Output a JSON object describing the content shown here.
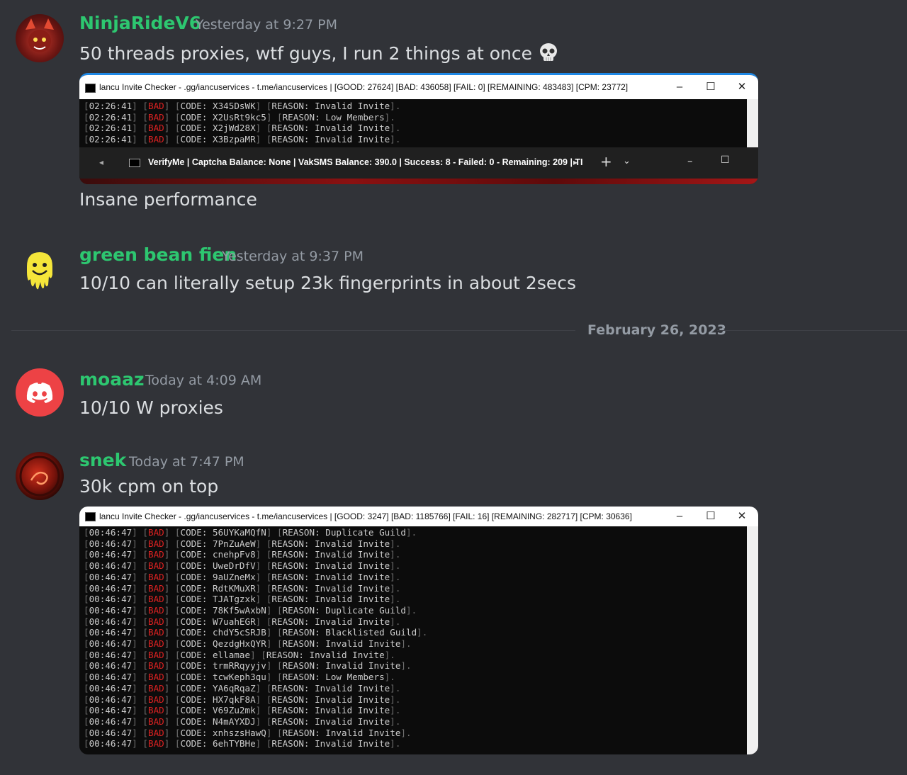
{
  "messages": [
    {
      "author": "NinjaRideV6",
      "timestamp": "Yesterday at 9:27 PM",
      "text": "50 threads proxies, wtf guys, I run 2 things at once",
      "emoji": "skull-emoji",
      "followup": "Insane performance",
      "screenshot": {
        "title": "lancu Invite Checker - .gg/iancuservices - t.me/iancuservices | [GOOD: 27624] [BAD: 436058] [FAIL: 0] [REMAINING: 483483] [CPM: 23772]",
        "lines": [
          {
            "time": "02:26:41",
            "status": "BAD",
            "code": "X345DsWK",
            "reason": "Invalid Invite"
          },
          {
            "time": "02:26:41",
            "status": "BAD",
            "code": "X2UsRt9kc5",
            "reason": "Low Members"
          },
          {
            "time": "02:26:41",
            "status": "BAD",
            "code": "X2jWd28X",
            "reason": "Invalid Invite"
          },
          {
            "time": "02:26:41",
            "status": "BAD",
            "code": "X3BzpaMR",
            "reason": "Invalid Invite"
          }
        ],
        "tab_title": "VerifyMe | Captcha Balance: None | VakSMS Balance: 390.0 | Success: 8 - Failed: 0 - Remaining: 209  | TI"
      }
    },
    {
      "author": "green bean fien",
      "timestamp": "Yesterday at 9:37 PM",
      "text": "10/10 can literally setup 23k fingerprints in about 2secs"
    },
    {
      "author": "moaaz",
      "timestamp": "Today at 4:09 AM",
      "text": "10/10 W proxies"
    },
    {
      "author": "snek",
      "timestamp": "Today at 7:47 PM",
      "text": "30k cpm on top",
      "screenshot": {
        "title": "lancu Invite Checker - .gg/iancuservices - t.me/iancuservices | [GOOD: 3247] [BAD: 1185766] [FAIL: 16] [REMAINING: 282717] [CPM: 30636]",
        "lines": [
          {
            "time": "00:46:47",
            "status": "BAD",
            "code": "56UYKaMQfN",
            "reason": "Duplicate Guild"
          },
          {
            "time": "00:46:47",
            "status": "BAD",
            "code": "7PnZuAeW",
            "reason": "Invalid Invite"
          },
          {
            "time": "00:46:47",
            "status": "BAD",
            "code": "cnehpFv8",
            "reason": "Invalid Invite"
          },
          {
            "time": "00:46:47",
            "status": "BAD",
            "code": "UweDrDfV",
            "reason": "Invalid Invite"
          },
          {
            "time": "00:46:47",
            "status": "BAD",
            "code": "9aUZneMx",
            "reason": "Invalid Invite"
          },
          {
            "time": "00:46:47",
            "status": "BAD",
            "code": "RdtKMuXR",
            "reason": "Invalid Invite"
          },
          {
            "time": "00:46:47",
            "status": "BAD",
            "code": "TJATgzxk",
            "reason": "Invalid Invite"
          },
          {
            "time": "00:46:47",
            "status": "BAD",
            "code": "78Kf5wAxbN",
            "reason": "Duplicate Guild"
          },
          {
            "time": "00:46:47",
            "status": "BAD",
            "code": "W7uahEGR",
            "reason": "Invalid Invite"
          },
          {
            "time": "00:46:47",
            "status": "BAD",
            "code": "chdY5cSRJB",
            "reason": "Blacklisted Guild"
          },
          {
            "time": "00:46:47",
            "status": "BAD",
            "code": "QezdgHxQYR",
            "reason": "Invalid Invite"
          },
          {
            "time": "00:46:47",
            "status": "BAD",
            "code": "ellamae",
            "reason": "Invalid Invite"
          },
          {
            "time": "00:46:47",
            "status": "BAD",
            "code": "trmRRqyyjv",
            "reason": "Invalid Invite"
          },
          {
            "time": "00:46:47",
            "status": "BAD",
            "code": "tcwKeph3qu",
            "reason": "Low Members"
          },
          {
            "time": "00:46:47",
            "status": "BAD",
            "code": "YA6qRqaZ",
            "reason": "Invalid Invite"
          },
          {
            "time": "00:46:47",
            "status": "BAD",
            "code": "HX7qkF8A",
            "reason": "Invalid Invite"
          },
          {
            "time": "00:46:47",
            "status": "BAD",
            "code": "V69Zu2mk",
            "reason": "Invalid Invite"
          },
          {
            "time": "00:46:47",
            "status": "BAD",
            "code": "N4mAYXDJ",
            "reason": "Invalid Invite"
          },
          {
            "time": "00:46:47",
            "status": "BAD",
            "code": "xnhszsHawQ",
            "reason": "Invalid Invite"
          },
          {
            "time": "00:46:47",
            "status": "BAD",
            "code": "6ehTYBHe",
            "reason": "Invalid Invite"
          }
        ]
      }
    }
  ],
  "divider_date": "February 26, 2023",
  "console_labels": {
    "code": "CODE:",
    "reason": "REASON:"
  },
  "colors": {
    "username": "#2dc770",
    "background": "#313338",
    "timestamp": "#949ba4",
    "bad": "#dd2222"
  }
}
